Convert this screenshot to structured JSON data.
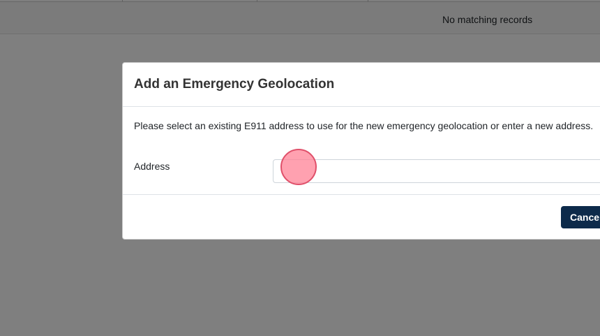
{
  "background": {
    "empty_table_text": "No matching records"
  },
  "modal": {
    "title": "Add an Emergency Geolocation",
    "description": "Please select an existing E911 address to use for the new emergency geolocation or enter a new address.",
    "address_label": "Address",
    "address_value": "",
    "address_placeholder": "",
    "cancel_label": "Cancel"
  },
  "colors": {
    "primary_button": "#0d2a4a",
    "backdrop": "rgba(0,0,0,0.5)",
    "click_marker": "#ff8296"
  }
}
